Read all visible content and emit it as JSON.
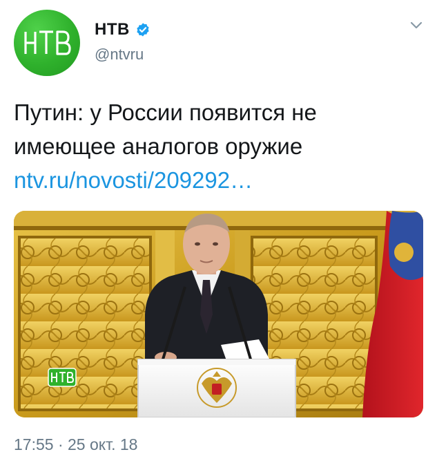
{
  "author": {
    "name": "НТВ",
    "handle": "@ntvru",
    "avatar_logo_text": "НТВ",
    "verified": true
  },
  "icons": {
    "verified": "verified-badge-icon",
    "caret": "chevron-down-icon"
  },
  "tweet": {
    "text_line1": "Путин: у России появится не",
    "text_line2": "имеющее аналогов оружие",
    "link": "ntv.ru/novosti/209292…"
  },
  "media": {
    "watermark_text": "НТВ",
    "description": "photo"
  },
  "meta": {
    "timestamp": "17:55 · 25 окт. 18"
  },
  "colors": {
    "link": "#1b95e0",
    "verified": "#1da1f2",
    "brand_green": "#2fb12c",
    "secondary_text": "#657786"
  }
}
